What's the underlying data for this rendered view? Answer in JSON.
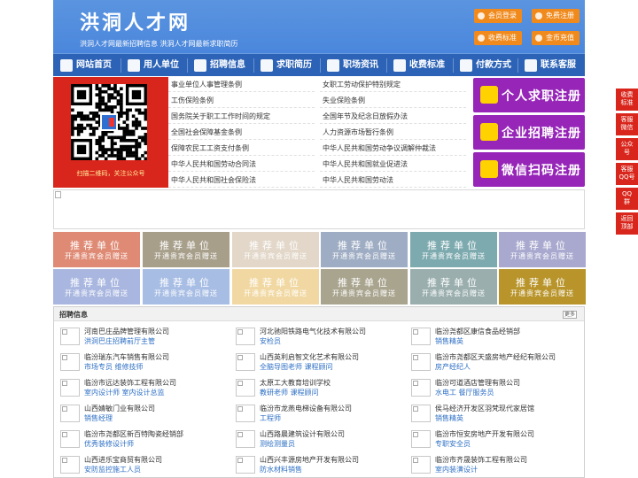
{
  "header": {
    "title": "洪洞人才网",
    "subtitle": "洪洞人才网最新招聘信息   洪洞人才网最新求职简历",
    "buttons": [
      "会员登录",
      "免费注册",
      "收费标准",
      "金币充值"
    ]
  },
  "nav": {
    "items": [
      "网站首页",
      "用人单位",
      "招聘信息",
      "求职简历",
      "职场资讯",
      "收费标准",
      "付款方式",
      "联系客服"
    ]
  },
  "qr": {
    "caption": "扫描二维码，关注公众号"
  },
  "law_links": [
    "事业单位人事管理条例",
    "女职工劳动保护特别规定",
    "工伤保险条例",
    "失业保险条例",
    "国务院关于职工工作时间的规定",
    "全国年节及纪念日放假办法",
    "全国社会保障基金条例",
    "人力资源市场暂行条例",
    "保障农民工工资支付条例",
    "中华人民共和国劳动争议调解仲裁法",
    "中华人民共和国劳动合同法",
    "中华人民共和国就业促进法",
    "中华人民共和国社会保险法",
    "中华人民共和国劳动法"
  ],
  "register": {
    "personal": "个人求职注册",
    "company": "企业招聘注册",
    "wechat": "微信扫码注册"
  },
  "recommend": {
    "line1": "推荐单位",
    "line2": "开通贵宾会员赠送",
    "colors": [
      "#df8a74",
      "#a89f8b",
      "#e2d7c8",
      "#9fadc4",
      "#7daaaf",
      "#a9a9cf",
      "#a9b7e0",
      "#a7bde4",
      "#f1d8a2",
      "#a9a48e",
      "#9aaeae",
      "#b8942a"
    ]
  },
  "jobs": {
    "title": "招聘信息",
    "more": "更多",
    "items": [
      {
        "company": "河南巴庄品牌管理有限公司",
        "positions": "洪洞巴庄招聘前厅主管"
      },
      {
        "company": "河北驰阳铁路电气化技术有限公司",
        "positions": "安检员"
      },
      {
        "company": "临汾尧都区康信食品经销部",
        "positions": "销售精英"
      },
      {
        "company": "临汾瑞东汽车销售有限公司",
        "positions": "市场专员  维修技师"
      },
      {
        "company": "山西英利启智文化艺术有限公司",
        "positions": "全脑导图老师  课程顾问"
      },
      {
        "company": "临汾市尧都区天盛房地产经纪有限公司",
        "positions": "房产经纪人"
      },
      {
        "company": "临汾市远达装饰工程有限公司",
        "positions": "室内设计师  室内设计总监"
      },
      {
        "company": "太原工大教育培训学校",
        "positions": "教研老师  课程顾问"
      },
      {
        "company": "临汾可道酒店管理有限公司",
        "positions": "水电工  餐厅服务员"
      },
      {
        "company": "山西婧敏门业有限公司",
        "positions": "销售经理"
      },
      {
        "company": "临汾市龙燕电梯设备有限公司",
        "positions": "工程师"
      },
      {
        "company": "侯马经济开发区羽梵现代家居馆",
        "positions": "销售精英"
      },
      {
        "company": "临汾市尧都区新百特陶瓷经销部",
        "positions": "优秀装修设计师"
      },
      {
        "company": "山西路晨建筑设计有限公司",
        "positions": "测绘测量员"
      },
      {
        "company": "临汾市恒安房地产开发有限公司",
        "positions": "专职安全员"
      },
      {
        "company": "山西进乐宝商贸有限公司",
        "positions": "安防监控施工人员"
      },
      {
        "company": "山西兴丰源房地产开发有限公司",
        "positions": "防水材料销售"
      },
      {
        "company": "临汾市齐晟装饰工程有限公司",
        "positions": "室内装潢设计"
      }
    ]
  },
  "float": [
    "收费\n标准",
    "客服\n微信",
    "公众\n号",
    "客服\nQQ号",
    "QQ\n群",
    "返回\n顶部"
  ]
}
